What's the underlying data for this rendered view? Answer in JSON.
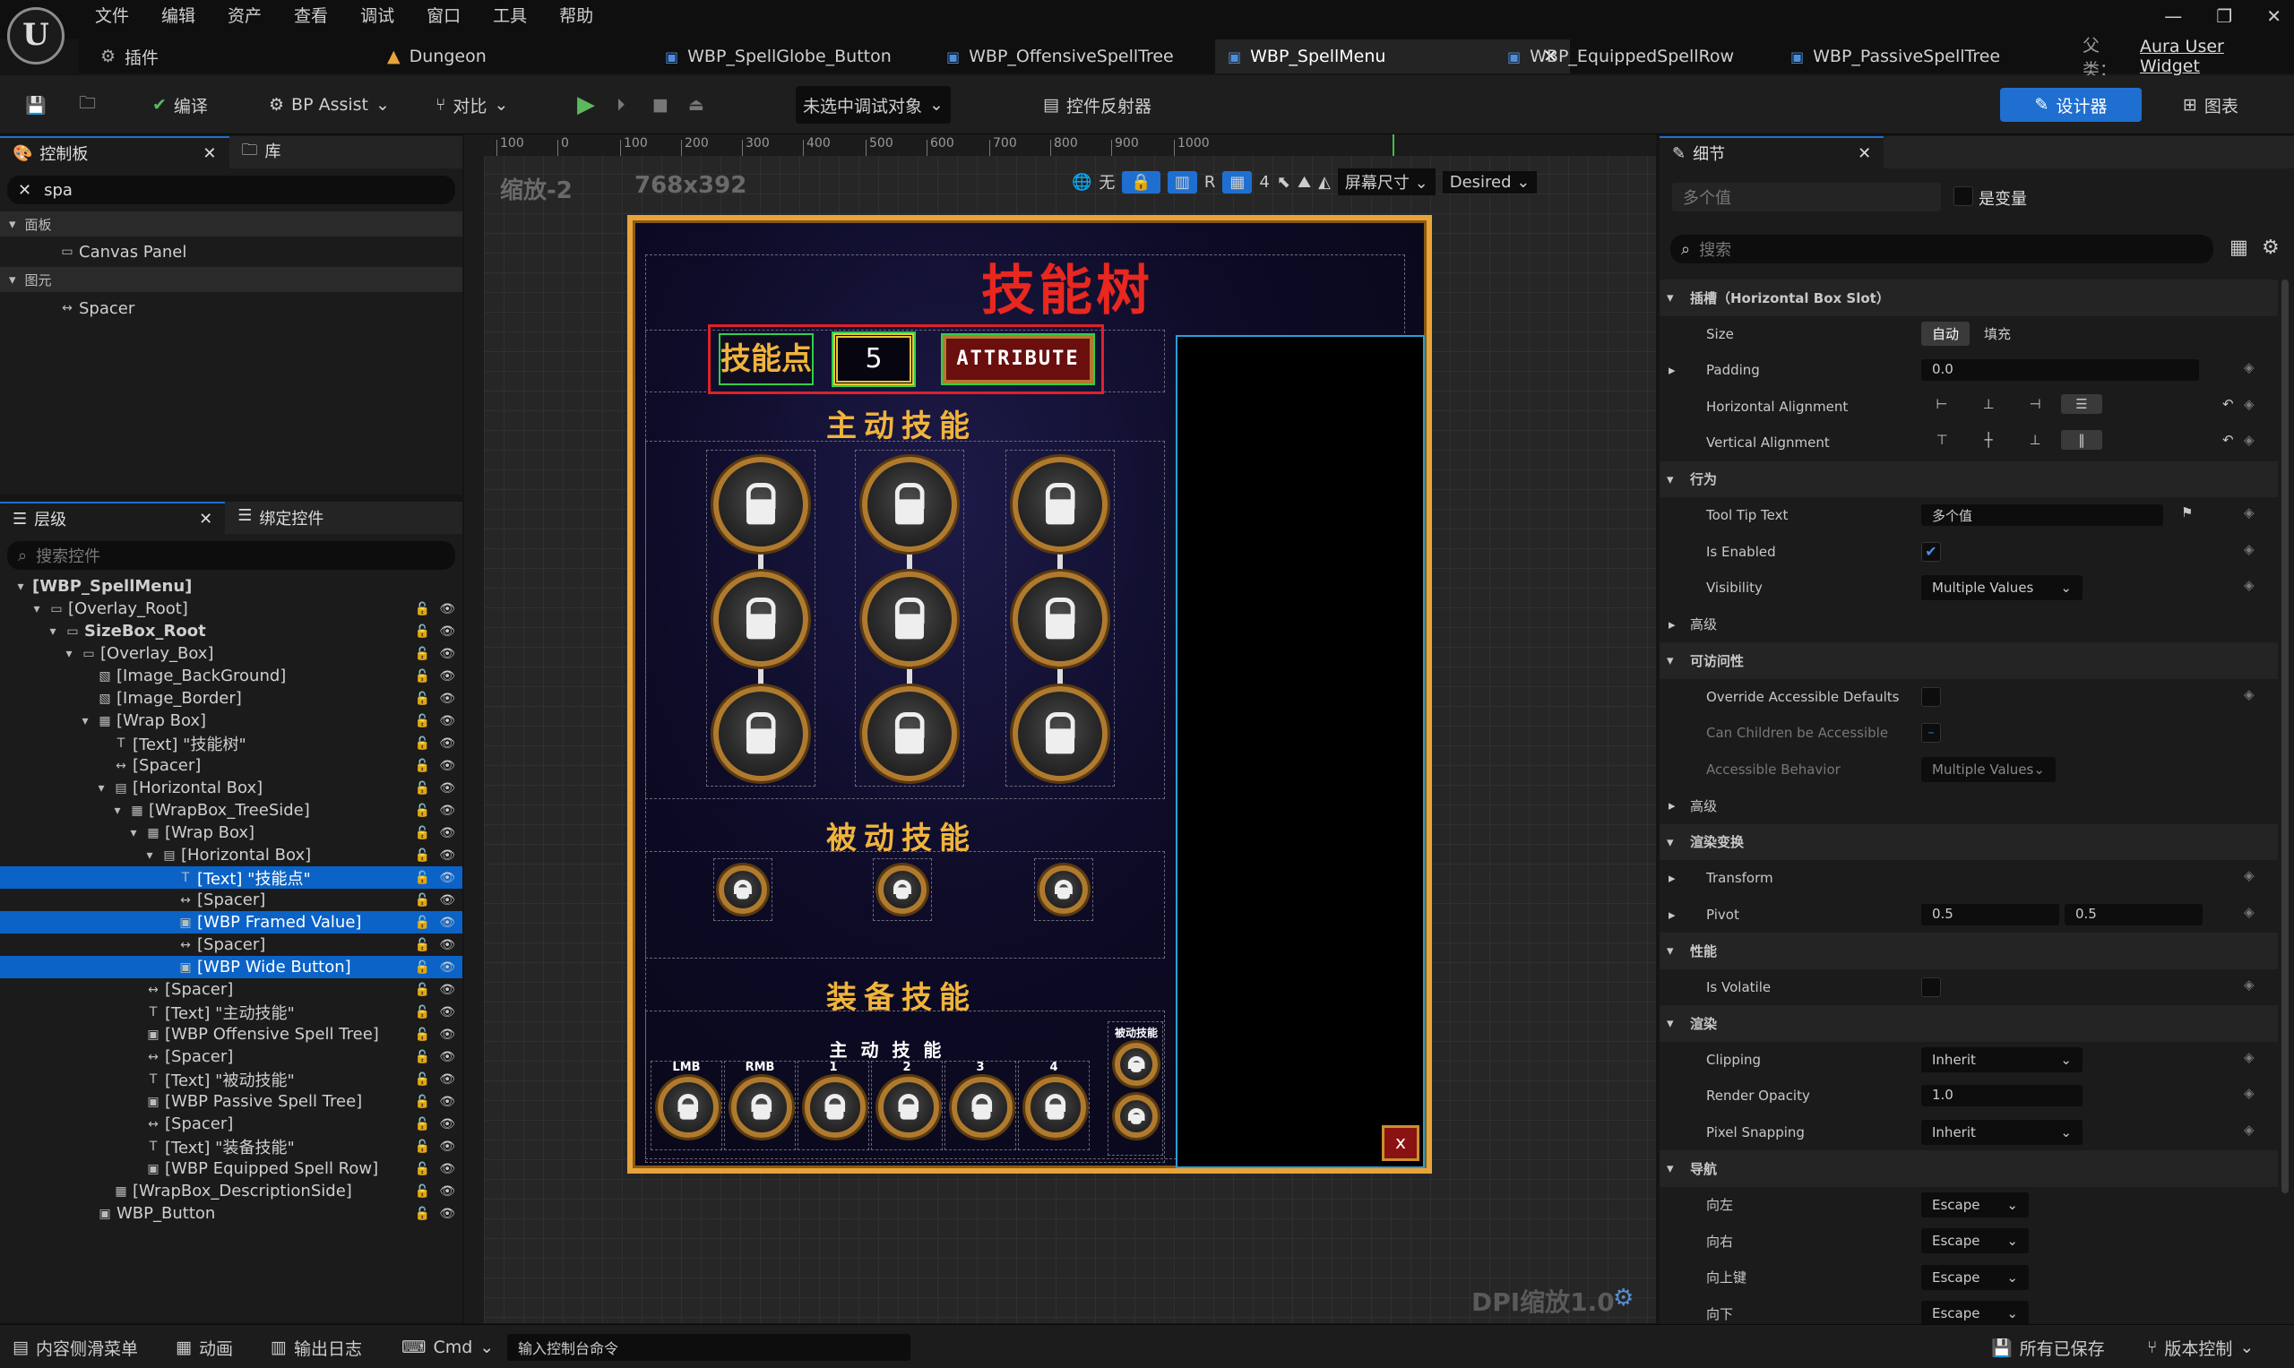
{
  "menu": [
    "文件",
    "编辑",
    "资产",
    "查看",
    "调试",
    "窗口",
    "工具",
    "帮助"
  ],
  "logo": "U",
  "plugin_label": "插件",
  "level_tab": "Dungeon",
  "tabs": [
    {
      "label": "WBP_SpellGlobe_Button"
    },
    {
      "label": "WBP_OffensiveSpellTree"
    },
    {
      "label": "WBP_SpellMenu"
    },
    {
      "label": "WBP_EquippedSpellRow"
    },
    {
      "label": "WBP_PassiveSpellTree"
    }
  ],
  "parent_class": {
    "label": "父类：",
    "value": "Aura User Widget"
  },
  "toolbar": {
    "compile": "编译",
    "bp_assist": "BP Assist",
    "diff": "对比",
    "debug_target": "未选中调试对象",
    "reflector": "控件反射器",
    "designer": "设计器",
    "graph": "图表"
  },
  "palette": {
    "tab": "控制板",
    "lib_tab": "库",
    "search": "spa",
    "sect1": "面板",
    "item1": "Canvas Panel",
    "sect2": "图元",
    "item2": "Spacer"
  },
  "hierarchy": {
    "tab": "层级",
    "bind_tab": "绑定控件",
    "search_placeholder": "搜索控件",
    "rows": [
      "[WBP_SpellMenu]",
      "[Overlay_Root]",
      "SizeBox_Root",
      "[Overlay_Box]",
      "[Image_BackGround]",
      "[Image_Border]",
      "[Wrap Box]",
      "[Text] \"技能树\"",
      "[Spacer]",
      "[Horizontal Box]",
      "[WrapBox_TreeSide]",
      "[Wrap Box]",
      "[Horizontal Box]",
      "[Text] \"技能点\"",
      "[Spacer]",
      "[WBP Framed Value]",
      "[Spacer]",
      "[WBP Wide Button]",
      "[Spacer]",
      "[Text] \"主动技能\"",
      "[WBP Offensive Spell Tree]",
      "[Spacer]",
      "[Text] \"被动技能\"",
      "[WBP Passive Spell Tree]",
      "[Spacer]",
      "[Text] \"装备技能\"",
      "[WBP Equipped Spell Row]",
      "[WrapBox_DescriptionSide]",
      "WBP_Button"
    ]
  },
  "viewport": {
    "zoom": "缩放-2",
    "resolution": "768x392",
    "ruler": [
      "100",
      "0",
      "100",
      "200",
      "300",
      "400",
      "500",
      "600",
      "700",
      "800",
      "900",
      "1000"
    ],
    "no_label": "无",
    "r_label": "R",
    "grid_num": "4",
    "screen_size": "屏幕尺寸",
    "desired": "Desired",
    "dpi": "DPI缩放1.0"
  },
  "widget": {
    "title": "技能树",
    "points_label": "技能点",
    "points_value": "5",
    "attribute_btn": "ATTRIBUTE",
    "offensive": "主动技能",
    "passive": "被动技能",
    "equipped": "装备技能",
    "row_title": "主 动 技 能",
    "row_passive": "被动技能",
    "slots": [
      "LMB",
      "RMB",
      "1",
      "2",
      "3",
      "4"
    ],
    "close": "x"
  },
  "details": {
    "tab": "细节",
    "multi": "多个值",
    "is_variable": "是变量",
    "search_placeholder": "搜索",
    "slot_section": "插槽（Horizontal Box Slot）",
    "size": "Size",
    "auto": "自动",
    "fill": "填充",
    "padding": "Padding",
    "padding_val": "0.0",
    "halign": "Horizontal Alignment",
    "valign": "Vertical Alignment",
    "behavior": "行为",
    "tooltip": "Tool Tip Text",
    "tooltip_val": "多个值",
    "enabled": "Is Enabled",
    "visibility": "Visibility",
    "visibility_val": "Multiple Values",
    "advanced": "高级",
    "access": "可访问性",
    "override": "Override Accessible Defaults",
    "children": "Can Children be Accessible",
    "acc_behavior": "Accessible Behavior",
    "acc_val": "Multiple Values",
    "render_transform": "渲染变换",
    "transform": "Transform",
    "pivot": "Pivot",
    "pivot_x": "0.5",
    "pivot_y": "0.5",
    "perf": "性能",
    "volatile": "Is Volatile",
    "render": "渲染",
    "clipping": "Clipping",
    "clipping_val": "Inherit",
    "opacity": "Render Opacity",
    "opacity_val": "1.0",
    "snapping": "Pixel Snapping",
    "snapping_val": "Inherit",
    "nav": "导航",
    "left": "向左",
    "right": "向右",
    "up": "向上键",
    "down": "向下",
    "escape": "Escape"
  },
  "statusbar": {
    "drawer": "内容侧滑菜单",
    "anim": "动画",
    "log": "输出日志",
    "cmd": "Cmd",
    "cmd_placeholder": "输入控制台命令",
    "saved": "所有已保存",
    "vcs": "版本控制"
  }
}
